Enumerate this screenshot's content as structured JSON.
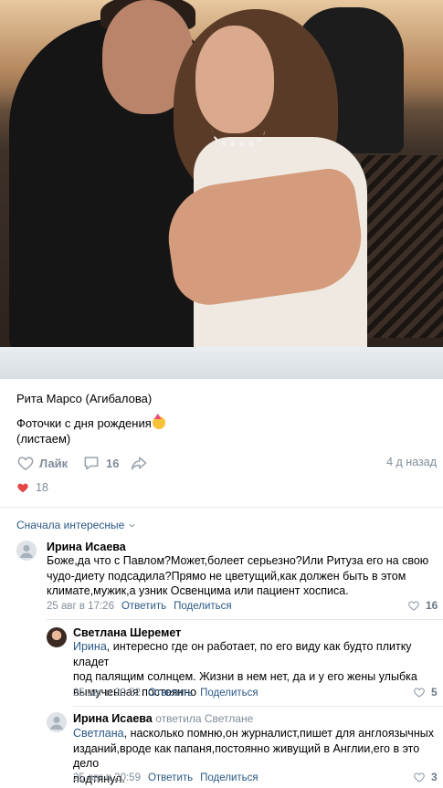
{
  "post": {
    "author": "Рита Марсо (Агибалова)",
    "text_line1": "Фоточки с дня рождения",
    "text_line2": "(листаем)",
    "like_label": "Лайк",
    "comments_count": "16",
    "time": "4 д назад",
    "likes_count": "18",
    "photo_icon": "birthday-party-emoji"
  },
  "comments_sort": "Сначала интересные",
  "comments": [
    {
      "author": "Ирина Исаева",
      "lines": [
        "Боже,да что с Павлом?Может,болеет серьезно?Или Ритуза его на свою",
        "чудо-диету подсадила?Прямо не цветущий,как должен быть в этом",
        "климате,мужик,а узник Освенцима или пациент хосписа."
      ],
      "date": "25 авг в 17:26",
      "reply": "Ответить",
      "share": "Поделиться",
      "likes": "16"
    },
    {
      "author": "Светлана Шеремет",
      "mention": "Ирина",
      "lines": [
        ", интересно где он работает, по его виду как будто плитку кладет",
        "под палящим солнцем. Жизни в нем нет, да и у его жены улыбка",
        "вымученная постоянно"
      ],
      "date": "25 авг в 20:52",
      "reply": "Ответить",
      "share": "Поделиться",
      "likes": "5"
    },
    {
      "author": "Ирина Исаева",
      "replied_to": "ответила Светлане",
      "mention": "Светлана",
      "lines": [
        ", насколько помню,он журналист,пишет для англоязычных",
        "изданий,вроде как папаня,постоянно живущий в Англии,его в это дело",
        "подтянул."
      ],
      "date": "25 авг в 20:59",
      "reply": "Ответить",
      "share": "Поделиться",
      "likes": "3"
    }
  ],
  "colors": {
    "link": "#2a5885",
    "muted": "#818c99",
    "like_red": "#e64646",
    "divider": "#e7e8ec"
  }
}
